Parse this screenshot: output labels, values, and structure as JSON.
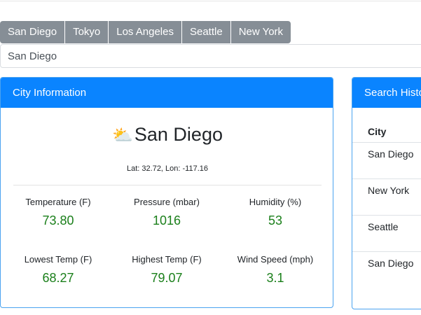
{
  "city_buttons": [
    "San Diego",
    "Tokyo",
    "Los Angeles",
    "Seattle",
    "New York"
  ],
  "search": {
    "value": "San Diego"
  },
  "city_card": {
    "header": "City Information",
    "weather_icon": "⛅",
    "city_name": "San Diego",
    "coords": "Lat: 32.72, Lon: -117.16",
    "stats": [
      {
        "label": "Temperature (F)",
        "value": "73.80"
      },
      {
        "label": "Pressure (mbar)",
        "value": "1016"
      },
      {
        "label": "Humidity (%)",
        "value": "53"
      },
      {
        "label": "Lowest Temp (F)",
        "value": "68.27"
      },
      {
        "label": "Highest Temp (F)",
        "value": "79.07"
      },
      {
        "label": "Wind Speed (mph)",
        "value": "3.1"
      }
    ]
  },
  "history_card": {
    "header": "Search History",
    "column": "City",
    "rows": [
      "San Diego",
      "New York",
      "Seattle",
      "San Diego"
    ]
  },
  "colors": {
    "button_bg": "#868e96",
    "header_bg": "#0a84ff",
    "value_green": "#1a7f1a"
  }
}
